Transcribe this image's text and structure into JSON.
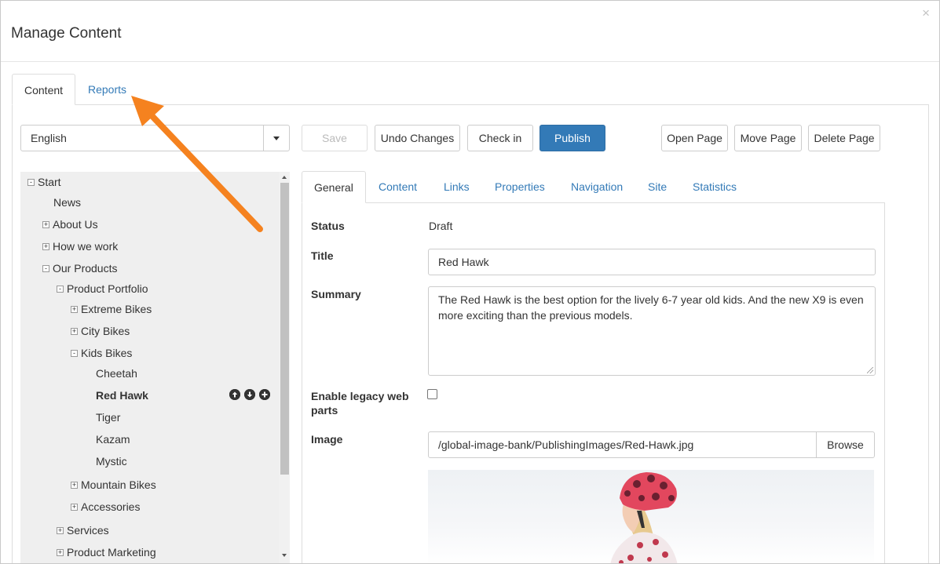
{
  "dialog": {
    "title": "Manage Content",
    "close_glyph": "×"
  },
  "top_tabs": [
    {
      "label": "Content",
      "active": true
    },
    {
      "label": "Reports",
      "active": false
    }
  ],
  "toolbar": {
    "language": "English",
    "save": "Save",
    "undo": "Undo Changes",
    "checkin": "Check in",
    "publish": "Publish",
    "open_page": "Open Page",
    "move_page": "Move Page",
    "delete_page": "Delete Page"
  },
  "tree": {
    "items": [
      {
        "label": "Start",
        "toggle": "-"
      },
      {
        "label": "News",
        "toggle": ""
      },
      {
        "label": "About Us",
        "toggle": "+"
      },
      {
        "label": "How we work",
        "toggle": "+"
      },
      {
        "label": "Our Products",
        "toggle": "-"
      },
      {
        "label": "Product Portfolio",
        "toggle": "-"
      },
      {
        "label": "Extreme Bikes",
        "toggle": "+"
      },
      {
        "label": "City Bikes",
        "toggle": "+"
      },
      {
        "label": "Kids Bikes",
        "toggle": "-"
      },
      {
        "label": "Cheetah",
        "toggle": ""
      },
      {
        "label": "Red Hawk",
        "toggle": "",
        "selected": true
      },
      {
        "label": "Tiger",
        "toggle": ""
      },
      {
        "label": "Kazam",
        "toggle": ""
      },
      {
        "label": "Mystic",
        "toggle": ""
      },
      {
        "label": "Mountain Bikes",
        "toggle": "+"
      },
      {
        "label": "Accessories",
        "toggle": "+"
      },
      {
        "label": "Services",
        "toggle": "+"
      },
      {
        "label": "Product Marketing",
        "toggle": "+"
      }
    ],
    "row_action_icons": [
      "arrow-up-circle-icon",
      "arrow-down-circle-icon",
      "plus-circle-icon"
    ]
  },
  "inner_tabs": [
    {
      "label": "General",
      "active": true
    },
    {
      "label": "Content"
    },
    {
      "label": "Links"
    },
    {
      "label": "Properties"
    },
    {
      "label": "Navigation"
    },
    {
      "label": "Site"
    },
    {
      "label": "Statistics"
    }
  ],
  "form": {
    "status_label": "Status",
    "status_value": "Draft",
    "title_label": "Title",
    "title_value": "Red Hawk",
    "summary_label": "Summary",
    "summary_value": "The Red Hawk is the best option for the lively 6-7 year old kids. And the new X9 is even more exciting than the previous models.",
    "legacy_label": "Enable legacy web parts",
    "legacy_checked": false,
    "image_label": "Image",
    "image_value": "/global-image-bank/PublishingImages/Red-Hawk.jpg",
    "browse": "Browse"
  },
  "annotation": {
    "arrow_color": "#f5821f"
  }
}
